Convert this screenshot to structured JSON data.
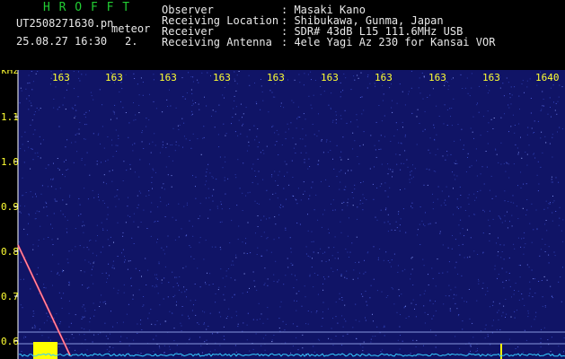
{
  "header": {
    "brand": "H R O F F T",
    "filename": "UT2508271630.pn",
    "meteor_label": "meteor",
    "datetime": "25.08.27 16:30",
    "count": "2.",
    "info_rows": [
      {
        "label": "Observer",
        "value": ": Masaki Kano"
      },
      {
        "label": "Receiving Location",
        "value": ": Shibukawa, Gunma, Japan"
      },
      {
        "label": "Receiver",
        "value": ": SDR# 43dB L15 111.6MHz USB"
      },
      {
        "label": "Receiving Antenna",
        "value": ": 4ele Yagi Az 230 for Kansai VOR"
      }
    ]
  },
  "spectrogram": {
    "y_unit": "kHz",
    "y_ticks": [
      "1.1",
      "1.0",
      "0.9",
      "0.8",
      "0.7",
      "0.6"
    ],
    "time_labels": [
      "163",
      "163",
      "163",
      "163",
      "163",
      "163",
      "163",
      "163",
      "163",
      "1640"
    ],
    "colors": {
      "background": "#101466",
      "text": "#ffff33",
      "meteor_trail": "#ff4060",
      "baseline": "#33ccff",
      "event": "#ffff00"
    }
  }
}
